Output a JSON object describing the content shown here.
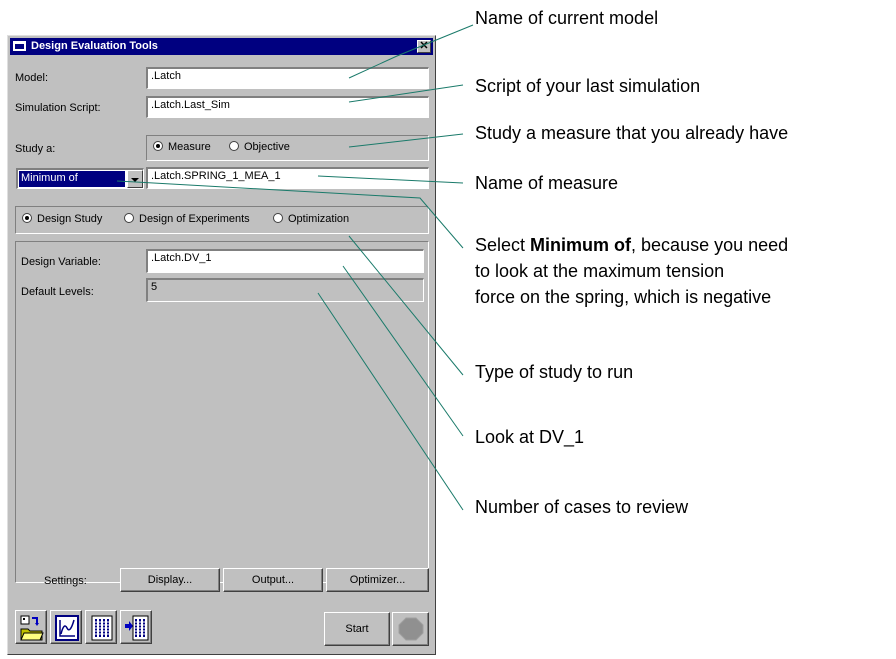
{
  "window": {
    "title": "Design Evaluation Tools",
    "close_glyph": "✕"
  },
  "form": {
    "model_label": "Model:",
    "model_value": ".Latch",
    "script_label": "Simulation Script:",
    "script_value": ".Latch.Last_Sim",
    "study_label": "Study a:",
    "measure_option": "Measure",
    "objective_option": "Objective",
    "min_combo_value": "Minimum of",
    "measure_value": ".Latch.SPRING_1_MEA_1",
    "design_study_option": "Design Study",
    "doe_option": "Design of Experiments",
    "optimization_option": "Optimization",
    "design_variable_label": "Design Variable:",
    "design_variable_value": ".Latch.DV_1",
    "default_levels_label": "Default Levels:",
    "default_levels_value": "5",
    "settings_label": "Settings:",
    "display_button": "Display...",
    "output_button": "Output...",
    "optimizer_button": "Optimizer...",
    "start_button": "Start"
  },
  "annotations": {
    "model_name": "Name of current model",
    "last_script": "Script of your last simulation",
    "study_measure": "Study a measure that you already have",
    "measure_name": "Name of measure",
    "select_prefix": "Select ",
    "select_bold": "Minimum of",
    "select_suffix": ", because you need",
    "select_line2": "to look at the maximum tension",
    "select_line3": "force on the spring, which is negative",
    "study_type": "Type of study to run",
    "look_dv": "Look at DV_1",
    "num_cases": "Number of cases to review"
  },
  "colors": {
    "titlebar": "#000080",
    "dialog_bg": "#c0c0c0",
    "leader_line": "#1a7a6a"
  },
  "icons": [
    "open-folder-icon",
    "plot-icon",
    "table-icon",
    "table-arrow-icon",
    "stop-icon"
  ]
}
